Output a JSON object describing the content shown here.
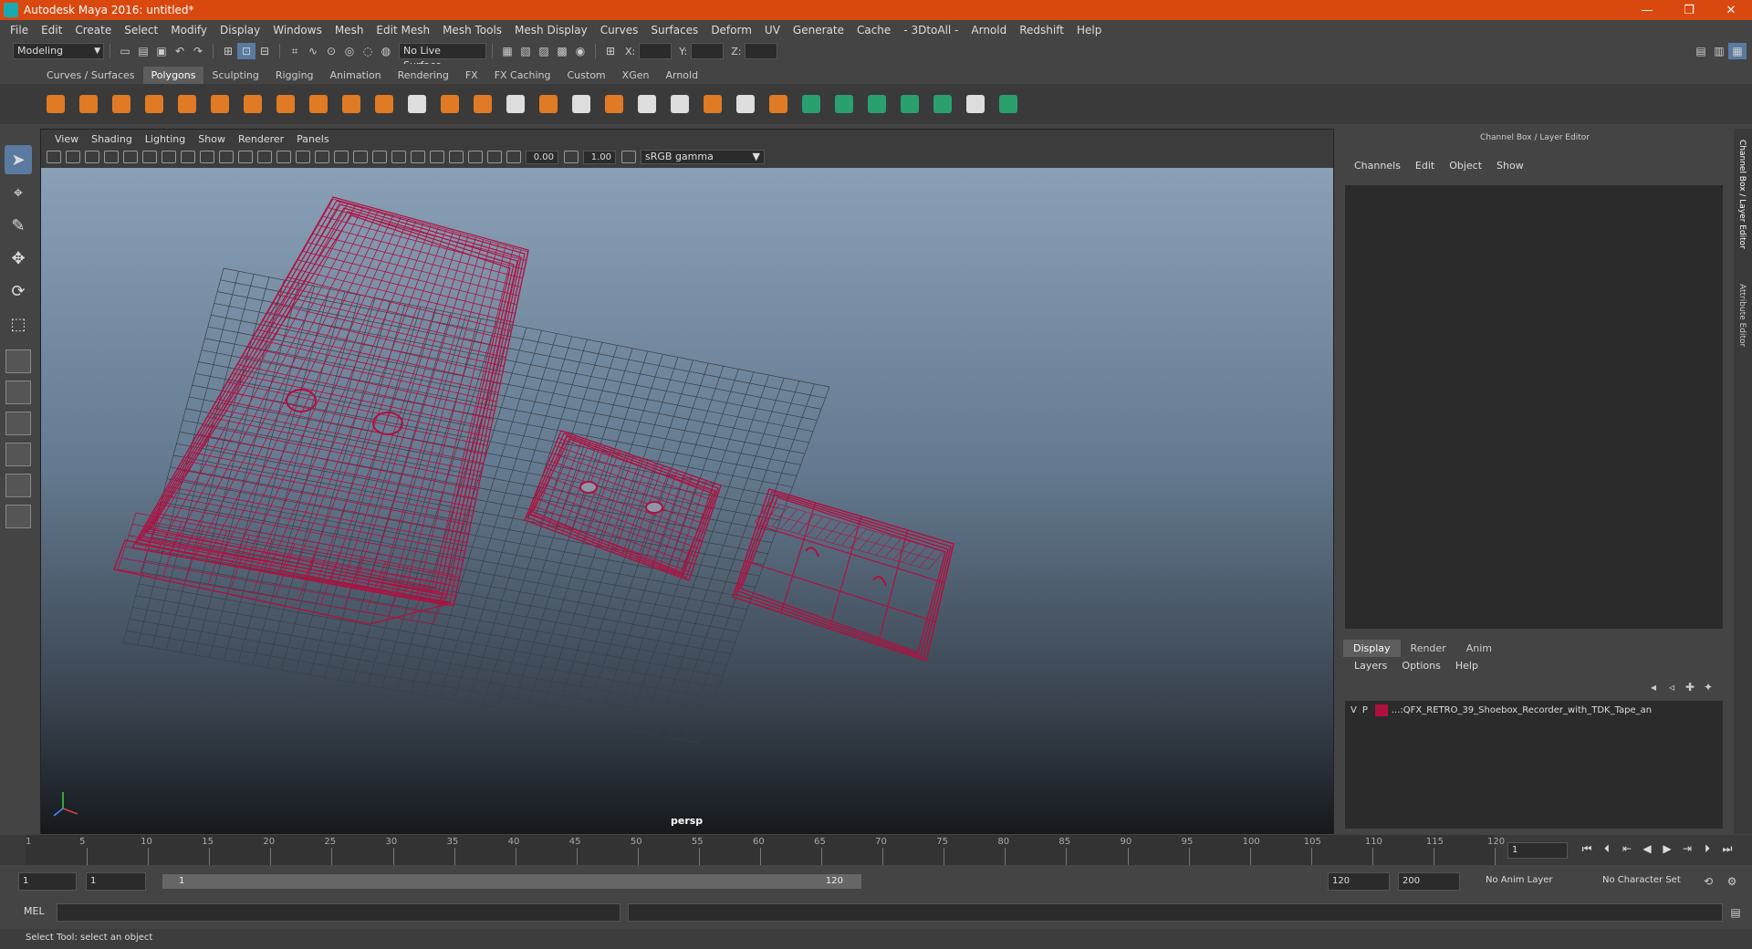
{
  "window": {
    "title": "Autodesk Maya 2016: untitled*",
    "controls": [
      "—",
      "❐",
      "✕"
    ]
  },
  "menubar": [
    "File",
    "Edit",
    "Create",
    "Select",
    "Modify",
    "Display",
    "Windows",
    "Mesh",
    "Edit Mesh",
    "Mesh Tools",
    "Mesh Display",
    "Curves",
    "Surfaces",
    "Deform",
    "UV",
    "Generate",
    "Cache",
    "- 3DtoAll -",
    "Arnold",
    "Redshift",
    "Help"
  ],
  "statusline": {
    "mode": "Modeling",
    "live_surface": "No Live Surface",
    "x_label": "X:",
    "y_label": "Y:",
    "z_label": "Z:"
  },
  "shelf_tabs": [
    "Curves / Surfaces",
    "Polygons",
    "Sculpting",
    "Rigging",
    "Animation",
    "Rendering",
    "FX",
    "FX Caching",
    "Custom",
    "XGen",
    "Arnold"
  ],
  "shelf_active": "Polygons",
  "viewport": {
    "menu": [
      "View",
      "Shading",
      "Lighting",
      "Show",
      "Renderer",
      "Panels"
    ],
    "exposure": "0.00",
    "gamma": "1.00",
    "colorspace": "sRGB gamma",
    "camera": "persp",
    "wire_color": "#b01040",
    "grid_color": "#3a3f46"
  },
  "right_panel": {
    "header": "Channel Box / Layer Editor",
    "channel_menu": [
      "Channels",
      "Edit",
      "Object",
      "Show"
    ],
    "layer_tabs": [
      "Display",
      "Render",
      "Anim"
    ],
    "layer_menu": [
      "Layers",
      "Options",
      "Help"
    ],
    "layer": {
      "v": "V",
      "p": "P",
      "name": "...:QFX_RETRO_39_Shoebox_Recorder_with_TDK_Tape_an",
      "color": "#b01040"
    },
    "side_tabs": [
      "Channel Box / Layer Editor",
      "Attribute Editor"
    ]
  },
  "timeline": {
    "ticks": [
      "5",
      "10",
      "15",
      "20",
      "25",
      "30",
      "35",
      "40",
      "45",
      "50",
      "55",
      "60",
      "65",
      "70",
      "75",
      "80",
      "85",
      "90",
      "95",
      "100",
      "105",
      "110",
      "115",
      "120"
    ],
    "start_marker": "1",
    "current_frame": "1"
  },
  "range": {
    "start": "1",
    "playback_start": "1",
    "slider_start": "1",
    "slider_end": "120",
    "playback_end": "120",
    "end": "200",
    "anim_layer": "No Anim Layer",
    "character_set": "No Character Set"
  },
  "mel": {
    "label": "MEL"
  },
  "help_text": "Select Tool: select an object"
}
